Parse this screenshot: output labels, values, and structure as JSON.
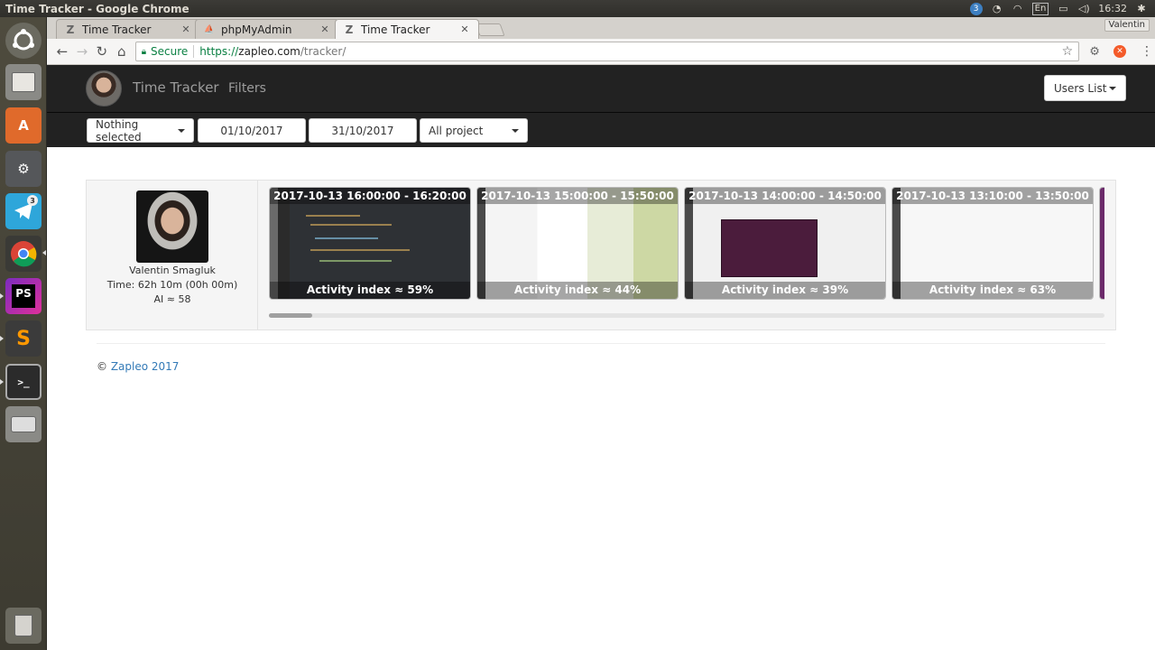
{
  "os": {
    "window_title": "Time Tracker - Google Chrome",
    "tray": {
      "badge": "3",
      "lang": "En",
      "clock": "16:32"
    },
    "launcher": [
      {
        "name": "ubuntu-dash-icon"
      },
      {
        "name": "files-icon"
      },
      {
        "name": "software-center-icon"
      },
      {
        "name": "settings-icon"
      },
      {
        "name": "telegram-icon",
        "badge": "3"
      },
      {
        "name": "chrome-icon"
      },
      {
        "name": "phpstorm-icon",
        "label": "PS"
      },
      {
        "name": "sublime-icon"
      },
      {
        "name": "terminal-icon"
      },
      {
        "name": "drive-icon"
      },
      {
        "name": "trash-icon"
      }
    ]
  },
  "browser": {
    "tabs": [
      {
        "label": "Time Tracker",
        "favicon": "Z"
      },
      {
        "label": "phpMyAdmin",
        "favicon": "pma"
      },
      {
        "label": "Time Tracker",
        "favicon": "Z"
      }
    ],
    "profile": "Valentin",
    "secure_label": "Secure",
    "url_scheme": "https://",
    "url_host": "zapleo.com",
    "url_path": "/tracker/"
  },
  "navbar": {
    "brand": "Time Tracker",
    "filters": "Filters",
    "users_list": "Users List"
  },
  "filters": {
    "select": "Nothing selected",
    "date_from": "01/10/2017",
    "date_to": "31/10/2017",
    "project": "All project"
  },
  "user": {
    "name": "Valentin Smagluk",
    "time": "Time: 62h 10m (00h 00m)",
    "ai": "AI ≈ 58"
  },
  "screenshots": [
    {
      "time": "2017-10-13 16:00:00 - 16:20:00",
      "activity": "Activity index ≈ 59%",
      "activity_pct": 59
    },
    {
      "time": "2017-10-13 15:00:00 - 15:50:00",
      "activity": "Activity index ≈ 44%",
      "activity_pct": 44
    },
    {
      "time": "2017-10-13 14:00:00 - 14:50:00",
      "activity": "Activity index ≈ 39%",
      "activity_pct": 39
    },
    {
      "time": "2017-10-13 13:10:00 - 13:50:00",
      "activity": "Activity index ≈ 63%",
      "activity_pct": 63
    }
  ],
  "footer": {
    "prefix": "©",
    "link": "Zapleo 2017"
  }
}
